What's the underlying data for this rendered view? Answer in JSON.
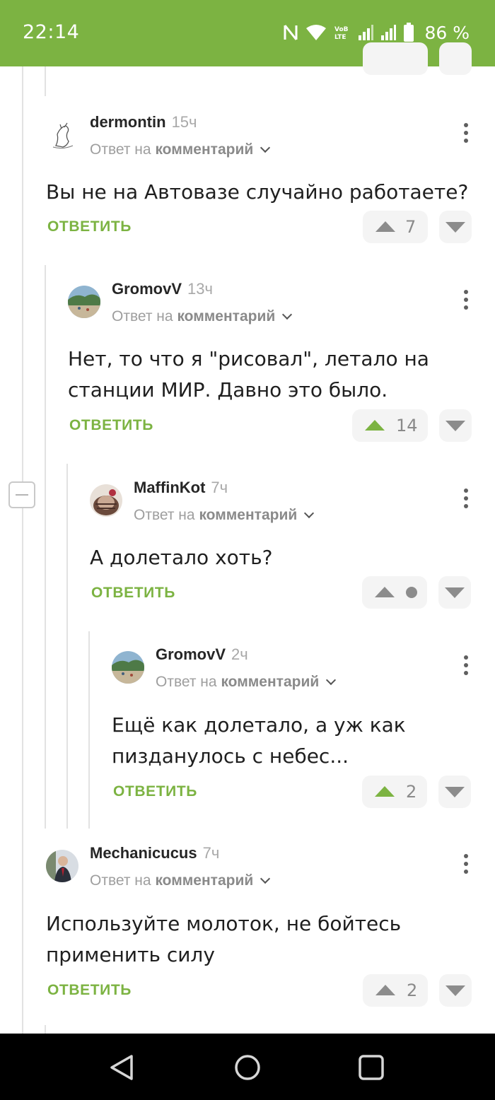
{
  "status_bar": {
    "time": "22:14",
    "battery": "86 %",
    "color": "#7cb342"
  },
  "comments": [
    {
      "username": "dermontin",
      "time_ago": "15ч",
      "reply_prefix": "Ответ на",
      "reply_target": "комментарий",
      "text_lines": [
        "Вы не на Автовазе случайно работаете?"
      ],
      "reply_label": "ОТВЕТИТЬ",
      "votes": "7",
      "upvote_active": false
    },
    {
      "username": "GromovV",
      "time_ago": "13ч",
      "reply_prefix": "Ответ на",
      "reply_target": "комментарий",
      "text_lines": [
        "Нет, то что я \"рисовал\", летало на",
        "станции МИР. Давно это было."
      ],
      "reply_label": "ОТВЕТИТЬ",
      "votes": "14",
      "upvote_active": true
    },
    {
      "username": "MaffinKot",
      "time_ago": "7ч",
      "reply_prefix": "Ответ на",
      "reply_target": "комментарий",
      "text_lines": [
        "А долетало хоть?"
      ],
      "reply_label": "ОТВЕТИТЬ",
      "votes": null,
      "upvote_active": false
    },
    {
      "username": "GromovV",
      "time_ago": "2ч",
      "reply_prefix": "Ответ на",
      "reply_target": "комментарий",
      "text_lines": [
        "Ещё как долетало, а уж как",
        "пизданулось с небес..."
      ],
      "reply_label": "ОТВЕТИТЬ",
      "votes": "2",
      "upvote_active": true
    },
    {
      "username": "Mechanicucus",
      "time_ago": "7ч",
      "reply_prefix": "Ответ на",
      "reply_target": "комментарий",
      "text_lines": [
        "Используйте молоток, не бойтесь",
        "применить силу"
      ],
      "reply_label": "ОТВЕТИТЬ",
      "votes": "2",
      "upvote_active": false
    }
  ],
  "nav_bar": {
    "back": "back-icon",
    "home": "home-icon",
    "recents": "recents-icon"
  }
}
